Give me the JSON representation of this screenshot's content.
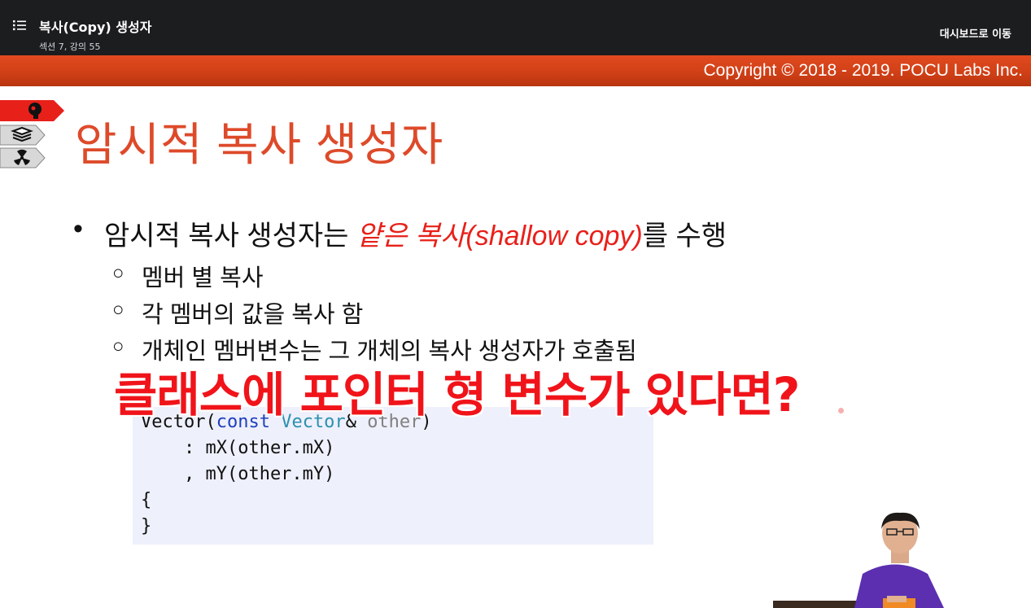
{
  "topbar": {
    "title": "복사(Copy) 생성자",
    "subtitle": "섹션 7, 강의 55",
    "dashboard_link": "대시보드로 이동"
  },
  "slide": {
    "copyright": "Copyright © 2018 - 2019. POCU Labs Inc.",
    "title": "암시적 복사 생성자",
    "bullet": {
      "prefix": "암시적 복사 생성자는 ",
      "emphasis": "얕은 복사(shallow copy)",
      "suffix": "를 수행"
    },
    "sub_bullets": [
      "멤버 별 복사",
      "각 멤버의 값을 복사 함",
      "개체인 멤버변수는 그 개체의 복사 생성자가 호출됨"
    ],
    "overlay": "클래스에 포인터 형 변수가 있다면?",
    "code": {
      "line1": {
        "name": "Vector(",
        "kw": "const",
        "type": "Vector",
        "amp": "& ",
        "param": "other",
        "close": ")"
      },
      "line2": "    : mX(other.mX)",
      "line3": "    , mY(other.mY)",
      "line4": "{",
      "line5": "}"
    }
  },
  "colors": {
    "topbar_bg": "#1c1d1f",
    "banner": "#d4431a",
    "title": "#dd4a2a",
    "emphasis": "#e8201a",
    "overlay": "#f0141a",
    "code_bg": "#eef0fb"
  },
  "icons": [
    "list-icon",
    "brain-icon",
    "books-icon",
    "radiation-icon"
  ]
}
